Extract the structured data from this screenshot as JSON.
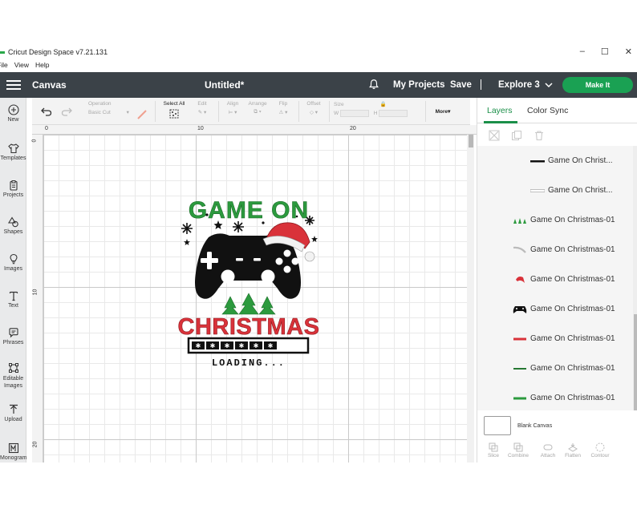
{
  "window": {
    "title": "Cricut Design Space  v7.21.131",
    "controls": [
      "–",
      "☐",
      "✕"
    ],
    "menu": [
      "File",
      "View",
      "Help"
    ]
  },
  "navbar": {
    "section": "Canvas",
    "document_title": "Untitled*",
    "my_projects": "My Projects",
    "save": "Save",
    "separator": "|",
    "machine": "Explore 3",
    "make_it": "Make It"
  },
  "left_tools": [
    {
      "label": "New",
      "icon": "plus-circle-icon"
    },
    {
      "label": "Templates",
      "icon": "shirt-icon"
    },
    {
      "label": "Projects",
      "icon": "clipboard-icon"
    },
    {
      "label": "Shapes",
      "icon": "shapes-icon"
    },
    {
      "label": "Images",
      "icon": "lightbulb-icon"
    },
    {
      "label": "Text",
      "icon": "text-t-icon"
    },
    {
      "label": "Phrases",
      "icon": "speech-bubble-icon"
    },
    {
      "label": "Editable Images",
      "icon": "editable-image-icon"
    },
    {
      "label": "Upload",
      "icon": "upload-icon"
    },
    {
      "label": "Monogram",
      "icon": "monogram-icon"
    }
  ],
  "edit_toolbar": {
    "operation_label": "Operation",
    "operation_value": "Basic Cut",
    "select_all": "Select All",
    "edit": "Edit",
    "align": "Align",
    "arrange": "Arrange",
    "flip": "Flip",
    "offset": "Offset",
    "size": "Size",
    "w": "W",
    "h": "H",
    "more": "More▾"
  },
  "rulers": {
    "top": [
      "0",
      "10",
      "20"
    ],
    "left": [
      "0",
      "10",
      "20"
    ]
  },
  "design": {
    "line1": "GAME ON",
    "line2": "CHRISTMAS",
    "line3": "LOADING...",
    "colors": {
      "green": "#2c9a3e",
      "red": "#d9323a",
      "black": "#111111"
    }
  },
  "right_panel": {
    "tabs": [
      "Layers",
      "Color Sync"
    ],
    "layers": [
      {
        "name": "Game On Christ...",
        "thumb": "black-line",
        "indent": true
      },
      {
        "name": "Game On Christ...",
        "thumb": "white-line",
        "indent": true
      },
      {
        "name": "Game On Christmas-01",
        "thumb": "green-trees",
        "indent": false
      },
      {
        "name": "Game On Christmas-01",
        "thumb": "white-swoosh",
        "indent": false
      },
      {
        "name": "Game On Christmas-01",
        "thumb": "santa-hat",
        "indent": false
      },
      {
        "name": "Game On Christmas-01",
        "thumb": "controller",
        "indent": false
      },
      {
        "name": "Game On Christmas-01",
        "thumb": "red-text",
        "indent": false
      },
      {
        "name": "Game On Christmas-01",
        "thumb": "green-snow",
        "indent": false
      },
      {
        "name": "Game On Christmas-01",
        "thumb": "green-text",
        "indent": false
      }
    ],
    "blank_canvas": "Blank Canvas",
    "bottom_tools": [
      "Slice",
      "Combine",
      "Attach",
      "Flatten",
      "Contour"
    ]
  }
}
